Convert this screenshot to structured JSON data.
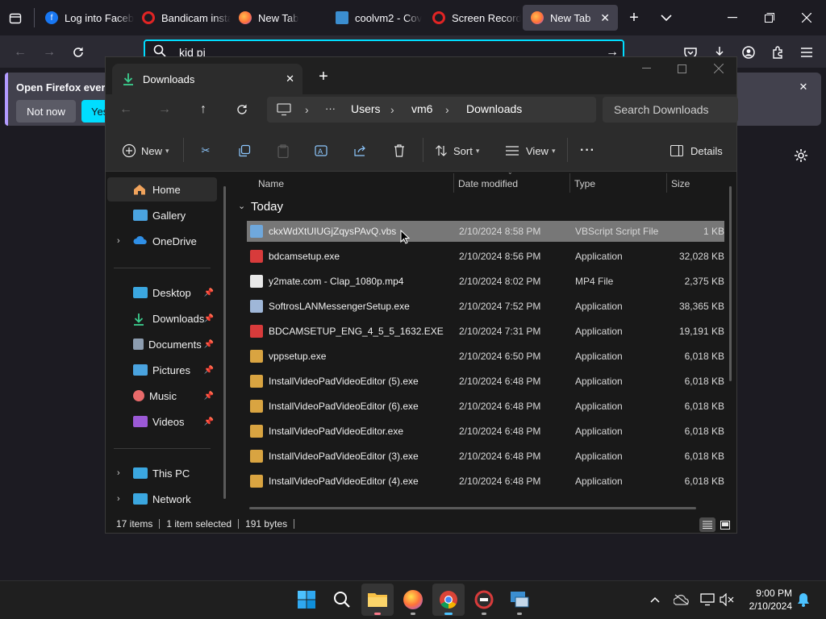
{
  "browser": {
    "tabs": [
      {
        "title": "Log into Facebook",
        "icon": "facebook-icon",
        "color": "#1877f2"
      },
      {
        "title": "Bandicam installer",
        "icon": "bandicam-icon",
        "color": "#e02424"
      },
      {
        "title": "New Tab",
        "icon": "firefox-icon",
        "color": "#ff7139"
      },
      {
        "title": "coolvm2 - Cov",
        "icon": "remote-desktop-icon",
        "color": "#3b8ed0"
      },
      {
        "title": "Screen Recorder",
        "icon": "record-icon",
        "color": "#e02424"
      },
      {
        "title": "New Tab",
        "icon": "firefox-icon",
        "color": "#ff7139"
      }
    ],
    "url_value": "kid pi",
    "notification": {
      "text": "Open Firefox every",
      "not_now": "Not now",
      "yes": "Yes"
    }
  },
  "explorer": {
    "tab_title": "Downloads",
    "breadcrumbs": [
      "Users",
      "vm6",
      "Downloads"
    ],
    "more_crumbs": "···",
    "search_placeholder": "Search Downloads",
    "toolbar": {
      "new": "New",
      "sort": "Sort",
      "view": "View",
      "more": "···",
      "details": "Details"
    },
    "nav": {
      "home": "Home",
      "gallery": "Gallery",
      "onedrive": "OneDrive",
      "desktop": "Desktop",
      "downloads": "Downloads",
      "documents": "Documents",
      "pictures": "Pictures",
      "music": "Music",
      "videos": "Videos",
      "thispc": "This PC",
      "network": "Network"
    },
    "columns": {
      "name": "Name",
      "date": "Date modified",
      "type": "Type",
      "size": "Size"
    },
    "group": "Today",
    "files": [
      {
        "name": "ckxWdXtUIUGjZqysPAvQ.vbs",
        "date": "2/10/2024 8:58 PM",
        "type": "VBScript Script File",
        "size": "1 KB",
        "icon": "vbs-file-icon",
        "color": "#6fa8dc"
      },
      {
        "name": "bdcamsetup.exe",
        "date": "2/10/2024 8:56 PM",
        "type": "Application",
        "size": "32,028 KB",
        "icon": "bandicam-icon",
        "color": "#d83b3b"
      },
      {
        "name": "y2mate.com - Clap_1080p.mp4",
        "date": "2/10/2024 8:02 PM",
        "type": "MP4 File",
        "size": "2,375 KB",
        "icon": "video-file-icon",
        "color": "#e8e8e8"
      },
      {
        "name": "SoftrosLANMessengerSetup.exe",
        "date": "2/10/2024 7:52 PM",
        "type": "Application",
        "size": "38,365 KB",
        "icon": "installer-icon",
        "color": "#9fb7d8"
      },
      {
        "name": "BDCAMSETUP_ENG_4_5_5_1632.EXE",
        "date": "2/10/2024 7:31 PM",
        "type": "Application",
        "size": "19,191 KB",
        "icon": "bandicam-icon",
        "color": "#d83b3b"
      },
      {
        "name": "vppsetup.exe",
        "date": "2/10/2024 6:50 PM",
        "type": "Application",
        "size": "6,018 KB",
        "icon": "installer-icon",
        "color": "#d9a441"
      },
      {
        "name": "InstallVideoPadVideoEditor (5).exe",
        "date": "2/10/2024 6:48 PM",
        "type": "Application",
        "size": "6,018 KB",
        "icon": "installer-icon",
        "color": "#d9a441"
      },
      {
        "name": "InstallVideoPadVideoEditor (6).exe",
        "date": "2/10/2024 6:48 PM",
        "type": "Application",
        "size": "6,018 KB",
        "icon": "installer-icon",
        "color": "#d9a441"
      },
      {
        "name": "InstallVideoPadVideoEditor.exe",
        "date": "2/10/2024 6:48 PM",
        "type": "Application",
        "size": "6,018 KB",
        "icon": "installer-icon",
        "color": "#d9a441"
      },
      {
        "name": "InstallVideoPadVideoEditor (3).exe",
        "date": "2/10/2024 6:48 PM",
        "type": "Application",
        "size": "6,018 KB",
        "icon": "installer-icon",
        "color": "#d9a441"
      },
      {
        "name": "InstallVideoPadVideoEditor (4).exe",
        "date": "2/10/2024 6:48 PM",
        "type": "Application",
        "size": "6,018 KB",
        "icon": "installer-icon",
        "color": "#d9a441"
      }
    ],
    "status": {
      "count": "17 items",
      "selected": "1 item selected",
      "bytes": "191 bytes"
    }
  },
  "taskbar": {
    "time": "9:00 PM",
    "date": "2/10/2024",
    "accent": "#0078d4"
  }
}
